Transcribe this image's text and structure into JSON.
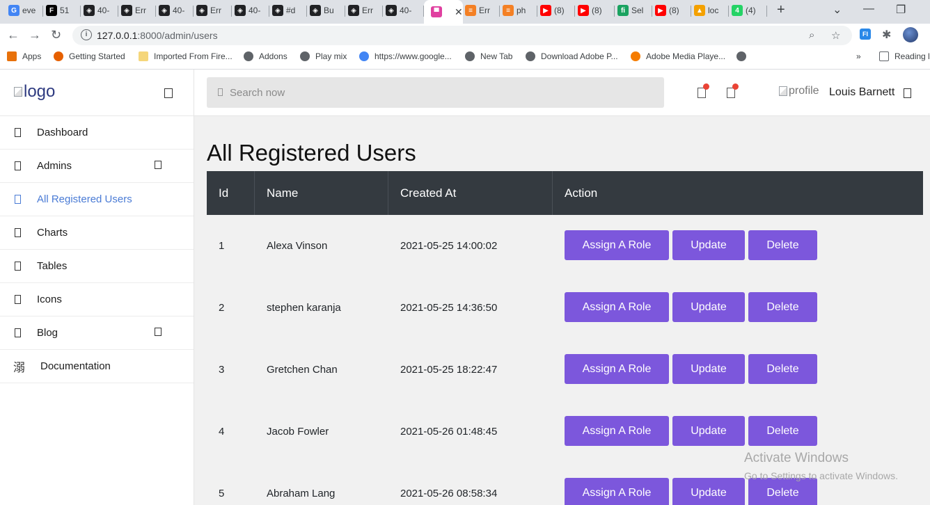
{
  "browser": {
    "tabs": [
      {
        "label": "eve",
        "favicon": "G",
        "color": "#4285f4"
      },
      {
        "label": "51",
        "favicon": "F",
        "color": "#000000"
      },
      {
        "label": "40-",
        "favicon": "◈",
        "color": "#202124"
      },
      {
        "label": "Err",
        "favicon": "◈",
        "color": "#202124"
      },
      {
        "label": "40-",
        "favicon": "◈",
        "color": "#202124"
      },
      {
        "label": "Err",
        "favicon": "◈",
        "color": "#202124"
      },
      {
        "label": "40-",
        "favicon": "◈",
        "color": "#202124"
      },
      {
        "label": "#d",
        "favicon": "◈",
        "color": "#202124"
      },
      {
        "label": "Bu",
        "favicon": "◈",
        "color": "#202124"
      },
      {
        "label": "Err",
        "favicon": "◈",
        "color": "#202124"
      },
      {
        "label": "40-",
        "favicon": "◈",
        "color": "#202124"
      },
      {
        "label": "",
        "favicon": "▀",
        "color": "#e040a0",
        "active": true
      },
      {
        "label": "Err",
        "favicon": "≡",
        "color": "#f48024"
      },
      {
        "label": "ph",
        "favicon": "≡",
        "color": "#f48024"
      },
      {
        "label": "(8)",
        "favicon": "▶",
        "color": "#ff0000"
      },
      {
        "label": "(8)",
        "favicon": "▶",
        "color": "#ff0000"
      },
      {
        "label": "Sel",
        "favicon": "fi",
        "color": "#1aa260"
      },
      {
        "label": "(8)",
        "favicon": "▶",
        "color": "#ff0000"
      },
      {
        "label": "loc",
        "favicon": "▲",
        "color": "#f4a100"
      },
      {
        "label": "(4)",
        "favicon": "4",
        "color": "#25d366"
      }
    ],
    "url_host": "127.0.0.1",
    "url_rest": ":8000/admin/users",
    "bookmarks": [
      {
        "label": "Apps",
        "icon": "apps-grid-icon",
        "color": "#e8710a"
      },
      {
        "label": "Getting Started",
        "icon": "firefox-icon",
        "color": "#e66000"
      },
      {
        "label": "Imported From Fire...",
        "icon": "folder-icon",
        "color": "#f5d67b"
      },
      {
        "label": "Addons",
        "icon": "globe-icon",
        "color": "#5f6368"
      },
      {
        "label": "Play mix",
        "icon": "globe-icon",
        "color": "#5f6368"
      },
      {
        "label": "https://www.google...",
        "icon": "google-icon",
        "color": "#4285f4"
      },
      {
        "label": "New Tab",
        "icon": "globe-icon",
        "color": "#5f6368"
      },
      {
        "label": "Download Adobe P...",
        "icon": "globe-icon",
        "color": "#5f6368"
      },
      {
        "label": "Adobe Media Playe...",
        "icon": "download-arrow-icon",
        "color": "#f57c00"
      },
      {
        "label": "",
        "icon": "globe-icon",
        "color": "#5f6368"
      }
    ],
    "overflow_label": "»",
    "reading_list": "Reading l"
  },
  "sidebar": {
    "logo_alt": "logo",
    "items": [
      {
        "label": "Dashboard",
        "has_caret": false
      },
      {
        "label": "Admins",
        "has_caret": true
      },
      {
        "label": "All Registered Users",
        "has_caret": false,
        "active": true
      },
      {
        "label": "Charts",
        "has_caret": false
      },
      {
        "label": "Tables",
        "has_caret": false
      },
      {
        "label": "Icons",
        "has_caret": false
      },
      {
        "label": "Blog",
        "has_caret": true
      }
    ],
    "documentation": {
      "label": "Documentation",
      "icon_glyph": "溺"
    }
  },
  "topbar": {
    "search_placeholder": "Search now",
    "profile_alt": "profile",
    "user_name": "Louis Barnett"
  },
  "main": {
    "title": "All Registered Users",
    "columns": [
      "Id",
      "Name",
      "Created At",
      "Action"
    ],
    "rows": [
      {
        "id": "1",
        "name": "Alexa Vinson",
        "created_at": "2021-05-25 14:00:02"
      },
      {
        "id": "2",
        "name": "stephen karanja",
        "created_at": "2021-05-25 14:36:50"
      },
      {
        "id": "3",
        "name": "Gretchen Chan",
        "created_at": "2021-05-25 18:22:47"
      },
      {
        "id": "4",
        "name": "Jacob Fowler",
        "created_at": "2021-05-26 01:48:45"
      },
      {
        "id": "5",
        "name": "Abraham Lang",
        "created_at": "2021-05-26 08:58:34"
      }
    ],
    "actions": {
      "assign": "Assign A Role",
      "update": "Update",
      "delete": "Delete"
    },
    "button_color": "#7c57dc"
  },
  "watermark": {
    "line1": "Activate Windows",
    "line2": "Go to Settings to activate Windows."
  }
}
